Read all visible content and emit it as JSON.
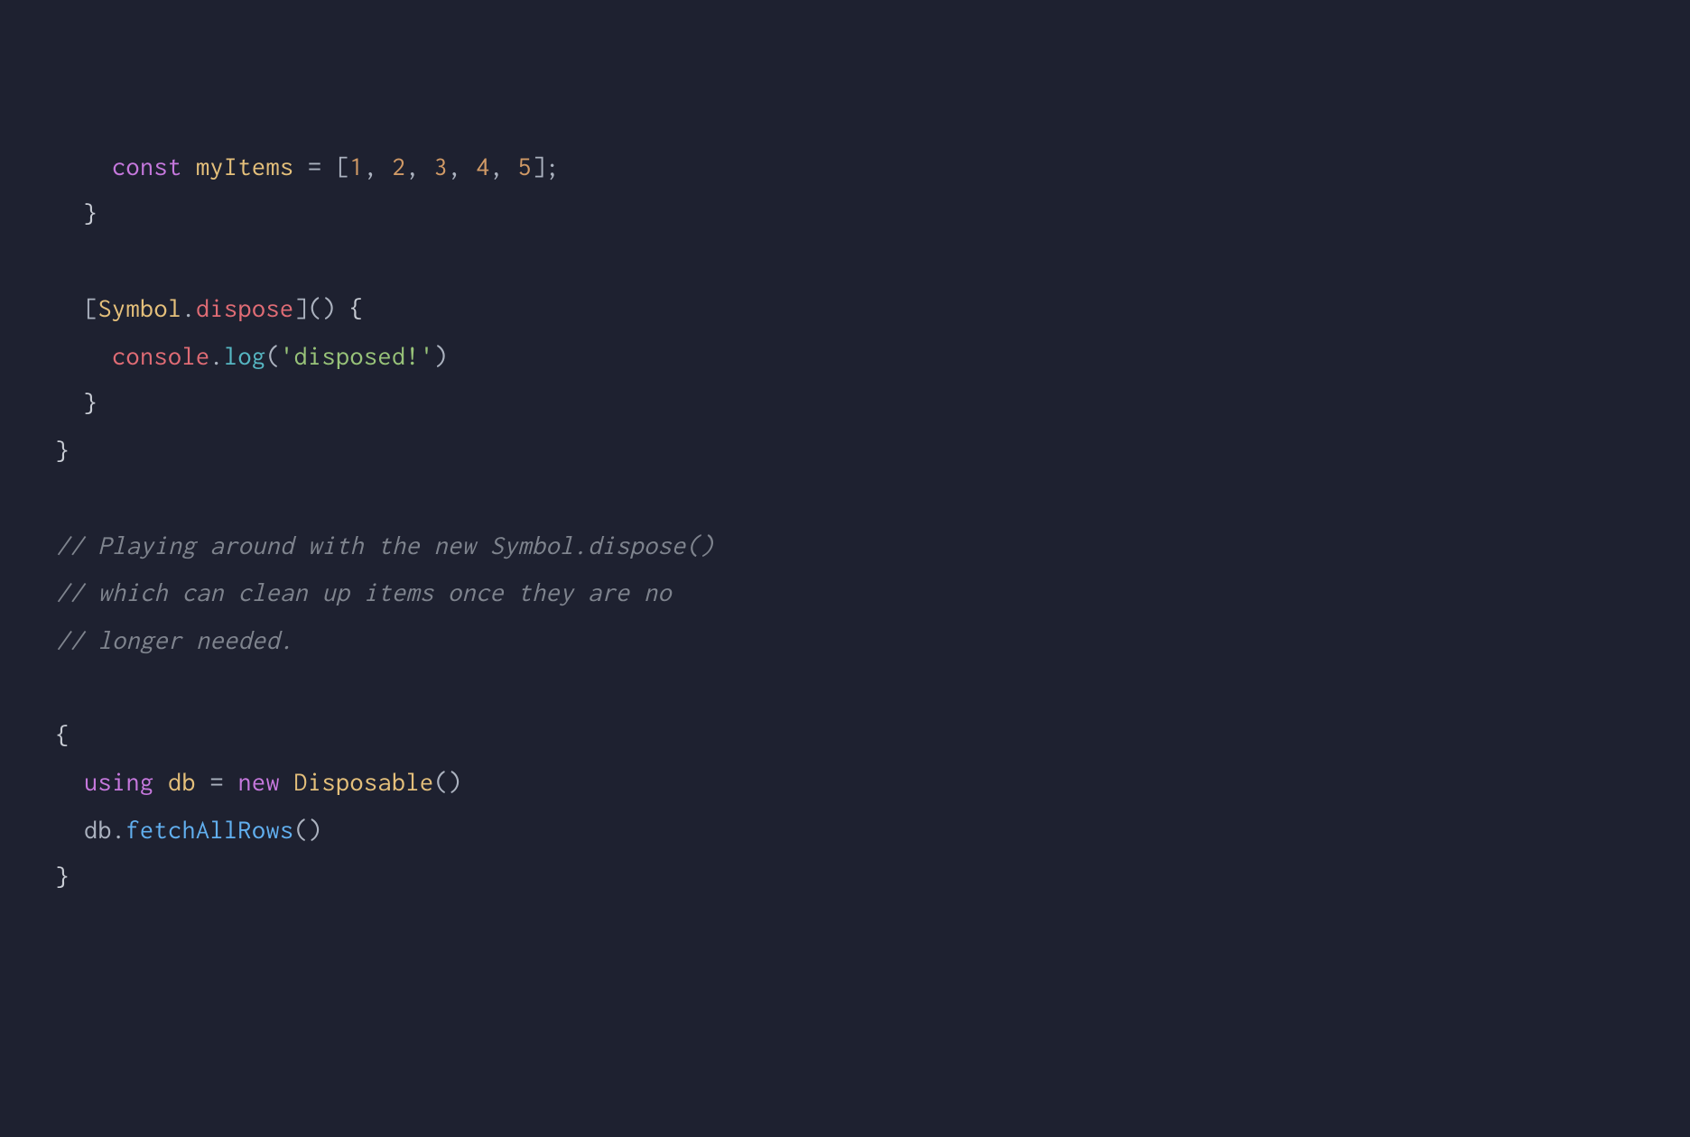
{
  "code": {
    "indent2": "  ",
    "indent4": "    ",
    "line1": {
      "const": "const",
      "space": " ",
      "myItems": "myItems",
      "equals": " = ",
      "lbracket": "[",
      "n1": "1",
      "comma": ", ",
      "n2": "2",
      "n3": "3",
      "n4": "4",
      "n5": "5",
      "rbracket": "]",
      "semi": ";"
    },
    "line2": {
      "brace": "}"
    },
    "line4": {
      "lbracket": "[",
      "symbol": "Symbol",
      "dot": ".",
      "dispose": "dispose",
      "rbracket": "]",
      "parens": "()",
      "space": " ",
      "lbrace": "{"
    },
    "line5": {
      "console": "console",
      "dot": ".",
      "log": "log",
      "lparen": "(",
      "str": "'disposed!'",
      "rparen": ")"
    },
    "line6": {
      "brace": "}"
    },
    "line7": {
      "brace": "}"
    },
    "line9": {
      "comment": "// Playing around with the new Symbol.dispose()"
    },
    "line10": {
      "comment": "// which can clean up items once they are no"
    },
    "line11": {
      "comment": "// longer needed."
    },
    "line13": {
      "brace": "{"
    },
    "line14": {
      "using": "using",
      "space": " ",
      "db": "db",
      "equals": " = ",
      "new": "new",
      "disposable": "Disposable",
      "parens": "()"
    },
    "line15": {
      "db": "db",
      "dot": ".",
      "fetchAllRows": "fetchAllRows",
      "parens": "()"
    },
    "line16": {
      "brace": "}"
    }
  }
}
